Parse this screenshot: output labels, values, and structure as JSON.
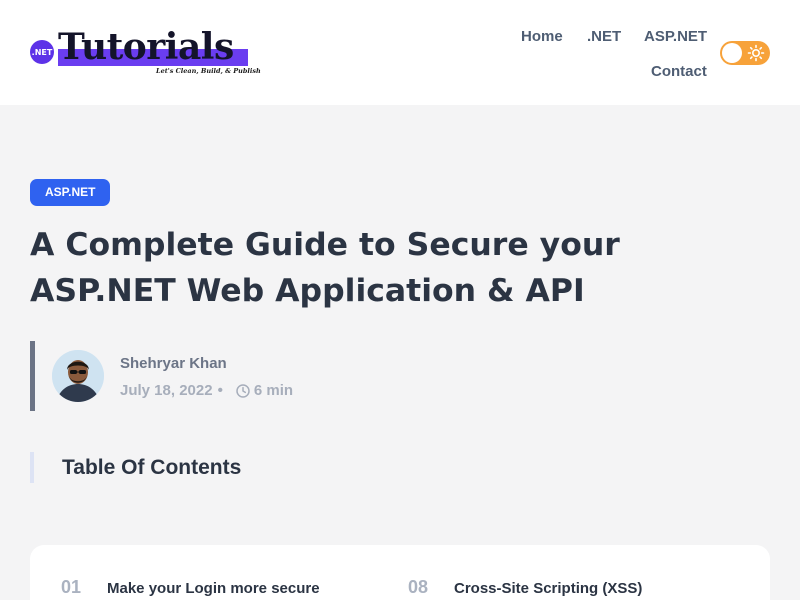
{
  "header": {
    "logo": {
      "badge": ".NET",
      "word": "Tutorials",
      "tagline": "Let's Clean, Build, & Publish"
    },
    "nav": [
      {
        "label": "Home"
      },
      {
        "label": ".NET"
      },
      {
        "label": "ASP.NET"
      },
      {
        "label": "Contact"
      }
    ],
    "theme_toggle": {
      "state": "light",
      "icons": [
        "moon-knob",
        "sun-icon"
      ],
      "color": "#f7a23a"
    }
  },
  "post": {
    "category": "ASP.NET",
    "title": "A Complete Guide to Secure your ASP.NET Web Application & API",
    "author": "Shehryar Khan",
    "date": "July 18, 2022",
    "separator": "•",
    "read_time": "6 min"
  },
  "toc": {
    "heading": "Table Of Contents",
    "items": [
      {
        "num": "01",
        "label": "Make your Login more secure"
      },
      {
        "num": "08",
        "label": "Cross-Site Scripting (XSS)"
      }
    ]
  },
  "colors": {
    "accent": "#2f62f0",
    "logo_purple": "#6a3df0",
    "text_dark": "#2b3443",
    "background": "#f4f4f5"
  }
}
